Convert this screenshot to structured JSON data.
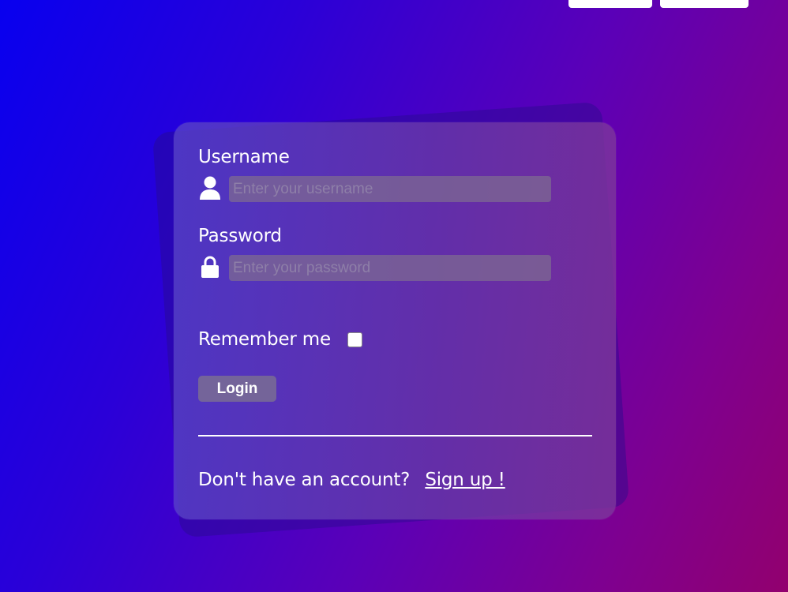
{
  "form": {
    "username_label": "Username",
    "username_placeholder": "Enter your username",
    "password_label": "Password",
    "password_placeholder": "Enter your password",
    "remember_label": "Remember me",
    "remember_checked": false,
    "login_label": "Login",
    "signup_prompt": "Don't have an account?",
    "signup_link": "Sign up !"
  },
  "icons": {
    "username": "user-icon",
    "password": "lock-icon"
  },
  "colors": {
    "background_start": "#0800ef",
    "background_end": "#92006e",
    "text": "#ffffff"
  }
}
